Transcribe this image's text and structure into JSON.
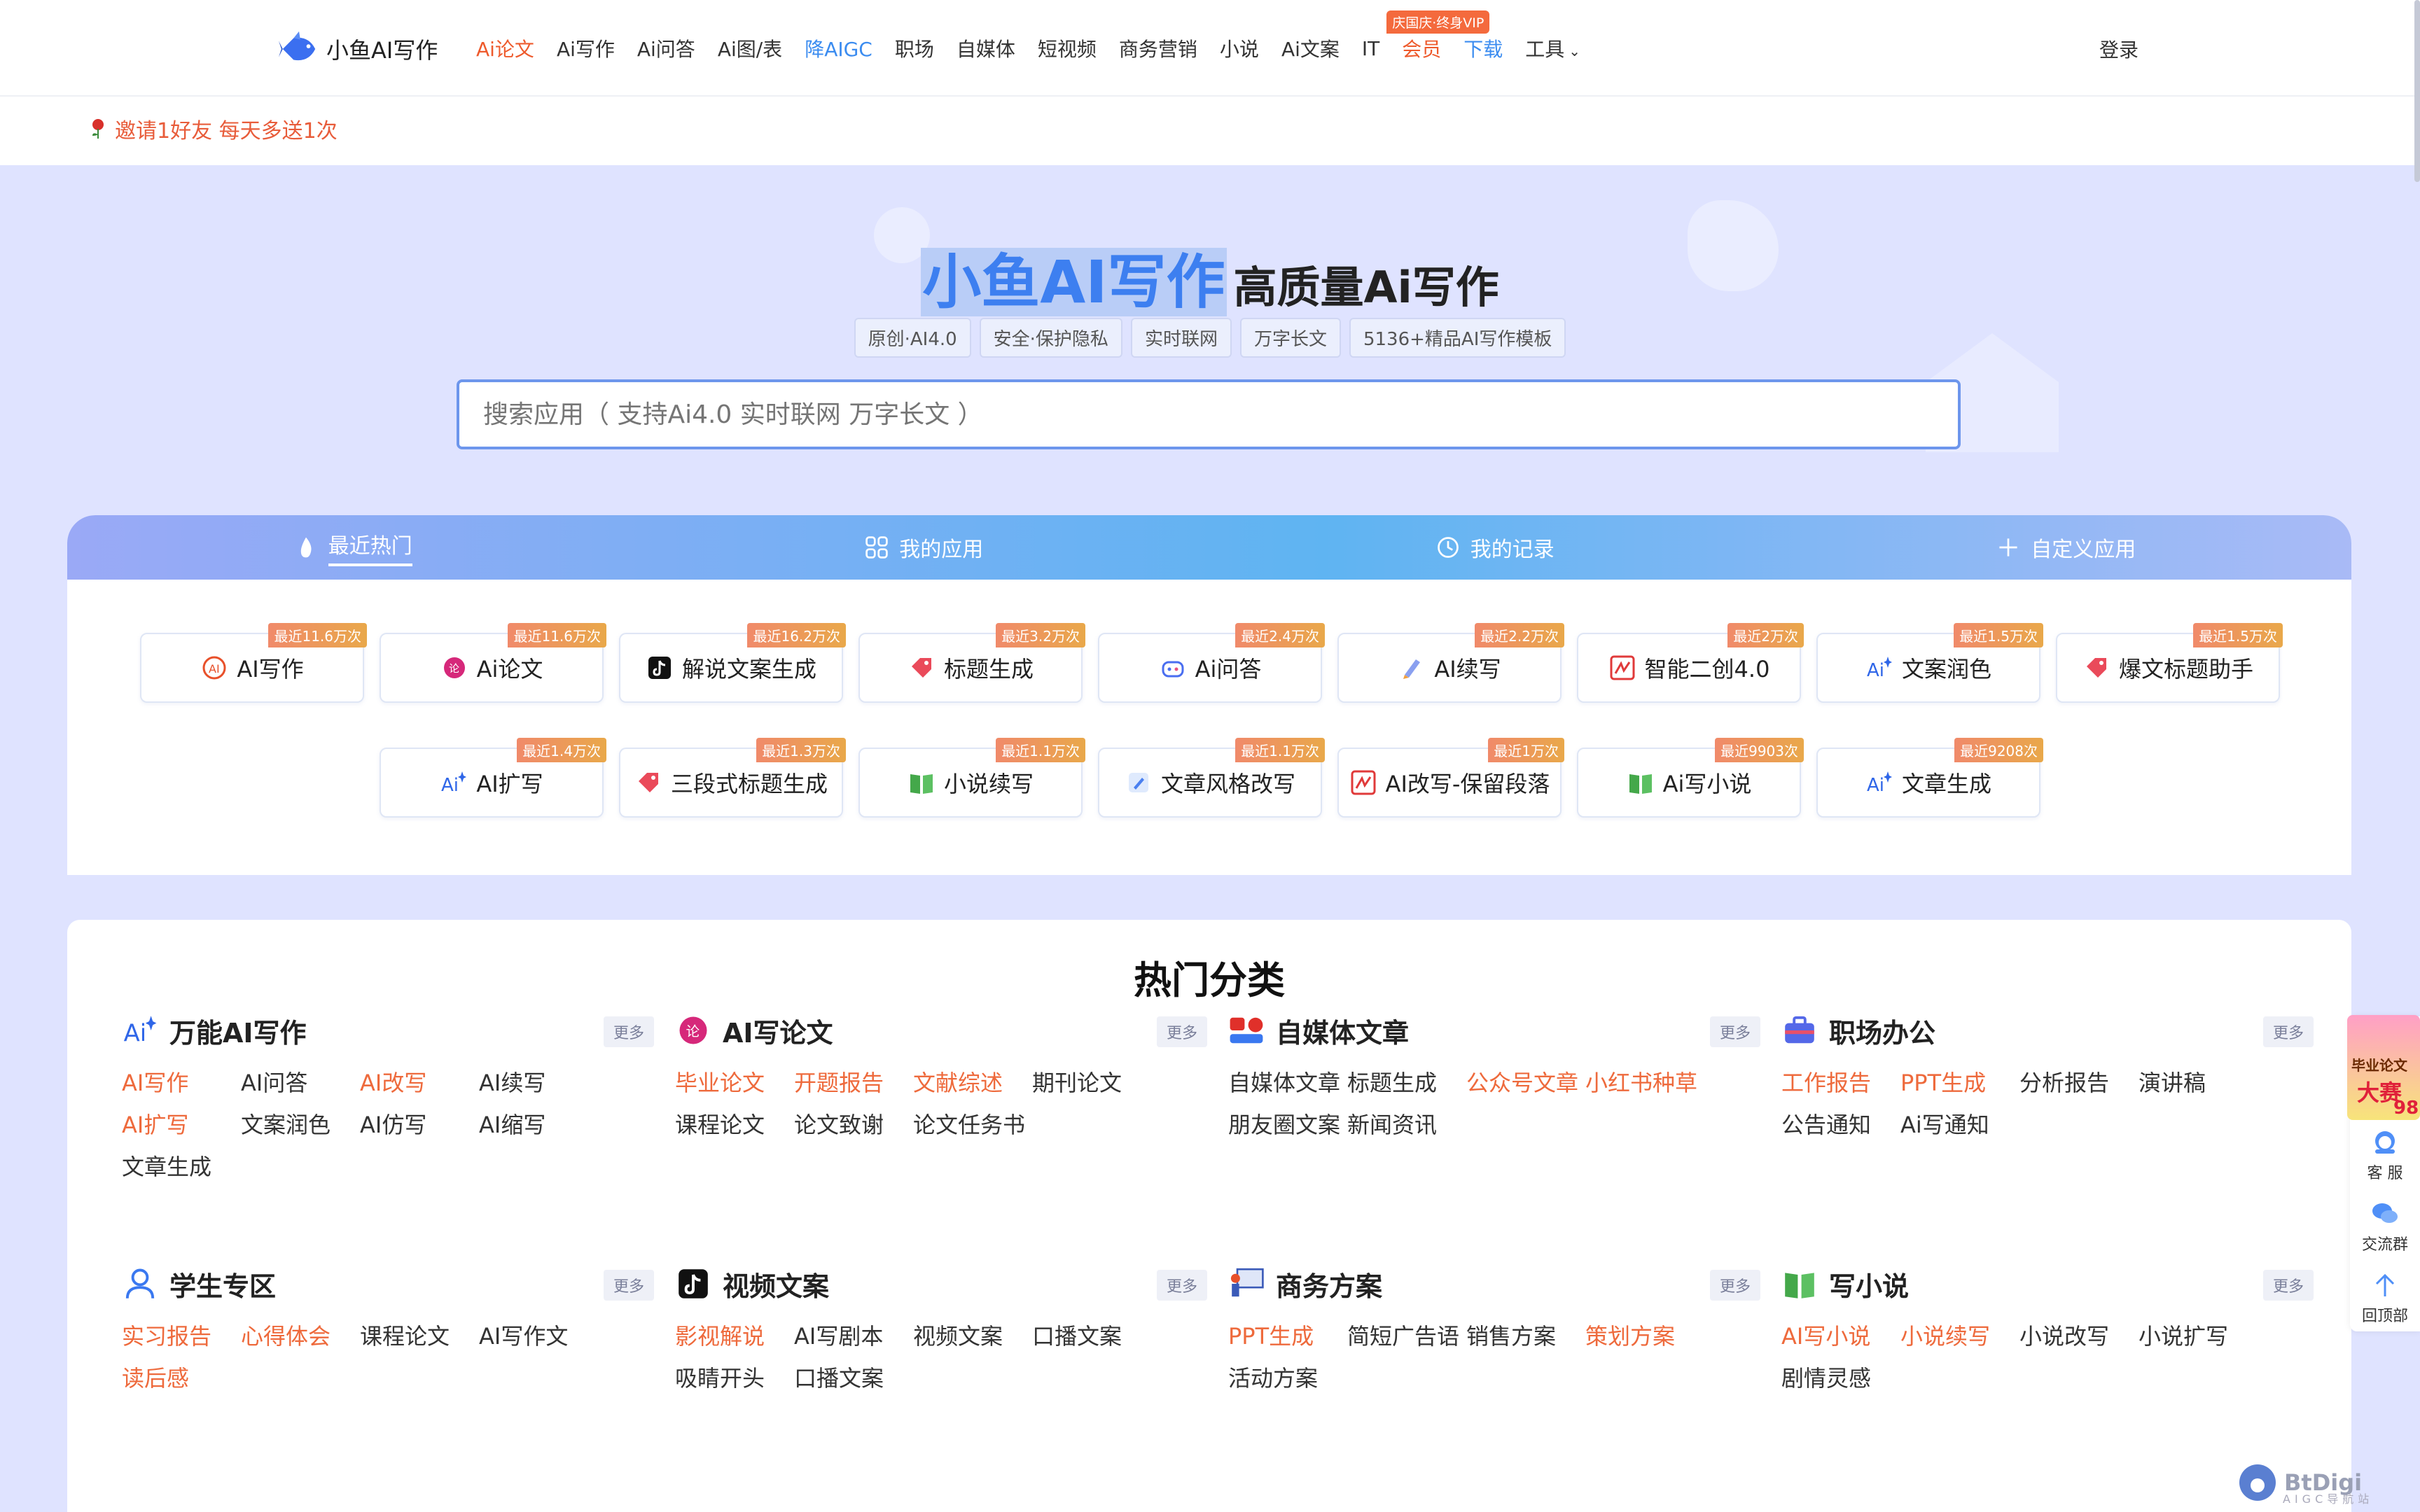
{
  "header": {
    "logo_text": "小鱼AI写作",
    "nav": [
      {
        "label": "Ai论文",
        "style": "red"
      },
      {
        "label": "Ai写作",
        "style": ""
      },
      {
        "label": "Ai问答",
        "style": ""
      },
      {
        "label": "Ai图/表",
        "style": ""
      },
      {
        "label": "降AIGC",
        "style": "blue"
      },
      {
        "label": "职场",
        "style": ""
      },
      {
        "label": "自媒体",
        "style": ""
      },
      {
        "label": "短视频",
        "style": ""
      },
      {
        "label": "商务营销",
        "style": ""
      },
      {
        "label": "小说",
        "style": ""
      },
      {
        "label": "Ai文案",
        "style": ""
      },
      {
        "label": "IT",
        "style": ""
      },
      {
        "label": "会员",
        "style": "red",
        "badge": "庆国庆·终身VIP"
      },
      {
        "label": "下载",
        "style": "blue"
      },
      {
        "label": "工具",
        "style": "",
        "dropdown": true
      }
    ],
    "login_label": "登录",
    "accent_color": "#ee5a2c"
  },
  "notice": {
    "text": "邀请1好友 每天多送1次"
  },
  "hero": {
    "brand": "小鱼AI写作",
    "subtitle": "高质量Ai写作",
    "tags": [
      "原创·AI4.0",
      "安全·保护隐私",
      "实时联网",
      "万字长文",
      "5136+精品AI写作模板"
    ],
    "search_placeholder": "搜索应用（ 支持Ai4.0 实时联网 万字长文 ）"
  },
  "tabs": [
    {
      "label": "最近热门",
      "icon": "flame-icon",
      "active": true
    },
    {
      "label": "我的应用",
      "icon": "grid-icon",
      "active": false
    },
    {
      "label": "我的记录",
      "icon": "clock-icon",
      "active": false
    },
    {
      "label": "自定义应用",
      "icon": "plus-icon",
      "active": false
    }
  ],
  "apps_row1": [
    {
      "name": "AI写作",
      "badge": "最近11.6万次",
      "icon": "ai-write-icon"
    },
    {
      "name": "Ai论文",
      "badge": "最近11.6万次",
      "icon": "paper-icon"
    },
    {
      "name": "解说文案生成",
      "badge": "最近16.2万次",
      "icon": "tiktok-icon"
    },
    {
      "name": "标题生成",
      "badge": "最近3.2万次",
      "icon": "tag-icon"
    },
    {
      "name": "Ai问答",
      "badge": "最近2.4万次",
      "icon": "chat-robot-icon"
    },
    {
      "name": "AI续写",
      "badge": "最近2.2万次",
      "icon": "pen-icon"
    },
    {
      "name": "智能二创4.0",
      "badge": "最近2万次",
      "icon": "edit-box-icon"
    },
    {
      "name": "文案润色",
      "badge": "最近1.5万次",
      "icon": "ai-sparkle-icon"
    },
    {
      "name": "爆文标题助手",
      "badge": "最近1.5万次",
      "icon": "tag-icon"
    }
  ],
  "apps_row2": [
    {
      "name": "AI扩写",
      "badge": "最近1.4万次",
      "icon": "ai-sparkle-icon"
    },
    {
      "name": "三段式标题生成",
      "badge": "最近1.3万次",
      "icon": "tag-icon"
    },
    {
      "name": "小说续写",
      "badge": "最近1.1万次",
      "icon": "book-icon"
    },
    {
      "name": "文章风格改写",
      "badge": "最近1.1万次",
      "icon": "edit-icon"
    },
    {
      "name": "AI改写-保留段落",
      "badge": "最近1万次",
      "icon": "edit-box-icon"
    },
    {
      "name": "Ai写小说",
      "badge": "最近9903次",
      "icon": "book-icon"
    },
    {
      "name": "文章生成",
      "badge": "最近9208次",
      "icon": "ai-sparkle-icon"
    }
  ],
  "categories_title": "热门分类",
  "more_label": "更多",
  "categories": [
    {
      "name": "万能AI写作",
      "icon": "ai-sparkle-icon",
      "links": [
        {
          "t": "AI写作",
          "hot": true
        },
        {
          "t": "AI问答",
          "hot": false
        },
        {
          "t": "AI改写",
          "hot": true
        },
        {
          "t": "AI续写",
          "hot": false
        },
        {
          "t": "AI扩写",
          "hot": true
        },
        {
          "t": "文案润色",
          "hot": false
        },
        {
          "t": "AI仿写",
          "hot": false
        },
        {
          "t": "AI缩写",
          "hot": false
        },
        {
          "t": "文章生成",
          "hot": false
        }
      ]
    },
    {
      "name": "AI写论文",
      "icon": "paper-icon",
      "links": [
        {
          "t": "毕业论文",
          "hot": true
        },
        {
          "t": "开题报告",
          "hot": true
        },
        {
          "t": "文献综述",
          "hot": true
        },
        {
          "t": "期刊论文",
          "hot": false
        },
        {
          "t": "课程论文",
          "hot": false
        },
        {
          "t": "论文致谢",
          "hot": false
        },
        {
          "t": "论文任务书",
          "hot": false
        }
      ]
    },
    {
      "name": "自媒体文章",
      "icon": "media-icon",
      "links": [
        {
          "t": "自媒体文章",
          "hot": false
        },
        {
          "t": "标题生成",
          "hot": false
        },
        {
          "t": "公众号文章",
          "hot": true
        },
        {
          "t": "小红书种草",
          "hot": true
        },
        {
          "t": "朋友圈文案",
          "hot": false
        },
        {
          "t": "新闻资讯",
          "hot": false
        }
      ]
    },
    {
      "name": "职场办公",
      "icon": "briefcase-icon",
      "links": [
        {
          "t": "工作报告",
          "hot": true
        },
        {
          "t": "PPT生成",
          "hot": true
        },
        {
          "t": "分析报告",
          "hot": false
        },
        {
          "t": "演讲稿",
          "hot": false
        },
        {
          "t": "公告通知",
          "hot": false
        },
        {
          "t": "Ai写通知",
          "hot": false
        }
      ]
    },
    {
      "name": "学生专区",
      "icon": "student-icon",
      "links": [
        {
          "t": "实习报告",
          "hot": true
        },
        {
          "t": "心得体会",
          "hot": true
        },
        {
          "t": "课程论文",
          "hot": false
        },
        {
          "t": "AI写作文",
          "hot": false
        },
        {
          "t": "读后感",
          "hot": true
        }
      ]
    },
    {
      "name": "视频文案",
      "icon": "tiktok-icon",
      "links": [
        {
          "t": "影视解说",
          "hot": true
        },
        {
          "t": "AI写剧本",
          "hot": false
        },
        {
          "t": "视频文案",
          "hot": false
        },
        {
          "t": "口播文案",
          "hot": false
        },
        {
          "t": "吸睛开头",
          "hot": false
        },
        {
          "t": "口播文案",
          "hot": false
        }
      ]
    },
    {
      "name": "商务方案",
      "icon": "presentation-icon",
      "links": [
        {
          "t": "PPT生成",
          "hot": true
        },
        {
          "t": "简短广告语",
          "hot": false
        },
        {
          "t": "销售方案",
          "hot": false
        },
        {
          "t": "策划方案",
          "hot": true
        },
        {
          "t": "活动方案",
          "hot": false
        }
      ]
    },
    {
      "name": "写小说",
      "icon": "book-icon",
      "links": [
        {
          "t": "AI写小说",
          "hot": true
        },
        {
          "t": "小说续写",
          "hot": true
        },
        {
          "t": "小说改写",
          "hot": false
        },
        {
          "t": "小说扩写",
          "hot": false
        },
        {
          "t": "剧情灵感",
          "hot": false
        }
      ]
    }
  ],
  "floatbar": {
    "promo_line1": "毕业论文",
    "promo_line2": "大赛",
    "promo_line3": "98",
    "service": "客 服",
    "group": "交流群",
    "top": "回顶部"
  },
  "watermark": {
    "text": "BtDigi",
    "sub": "AIGC导航站"
  }
}
